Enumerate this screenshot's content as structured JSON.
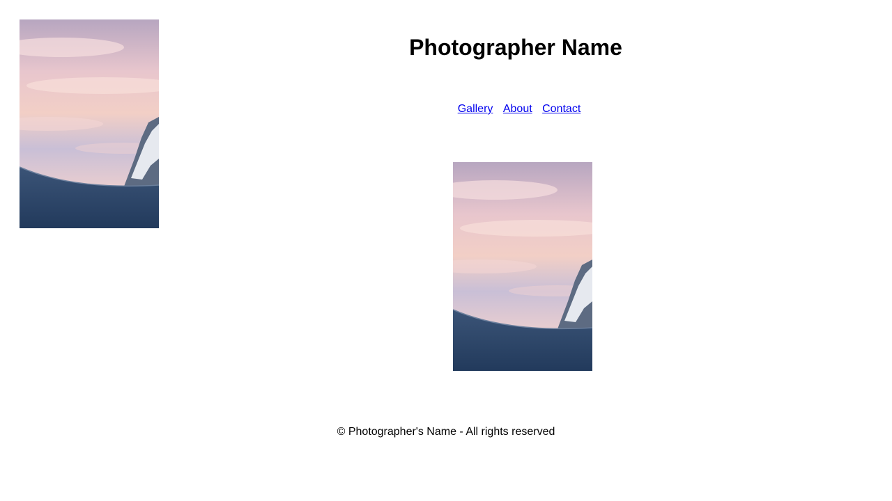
{
  "header": {
    "title": "Photographer Name"
  },
  "nav": {
    "items": [
      {
        "label": "Gallery"
      },
      {
        "label": "About"
      },
      {
        "label": "Contact"
      }
    ]
  },
  "footer": {
    "text": "© Photographer's Name - All rights reserved"
  },
  "colors": {
    "link": "#0000ee",
    "sky_top": "#c9a3b4",
    "sky_mid": "#f0c8c4",
    "snow_dark": "#2a4468"
  },
  "images": [
    {
      "name": "snowy-mountain-sunset-photo"
    },
    {
      "name": "snowy-mountain-sunset-photo"
    }
  ]
}
